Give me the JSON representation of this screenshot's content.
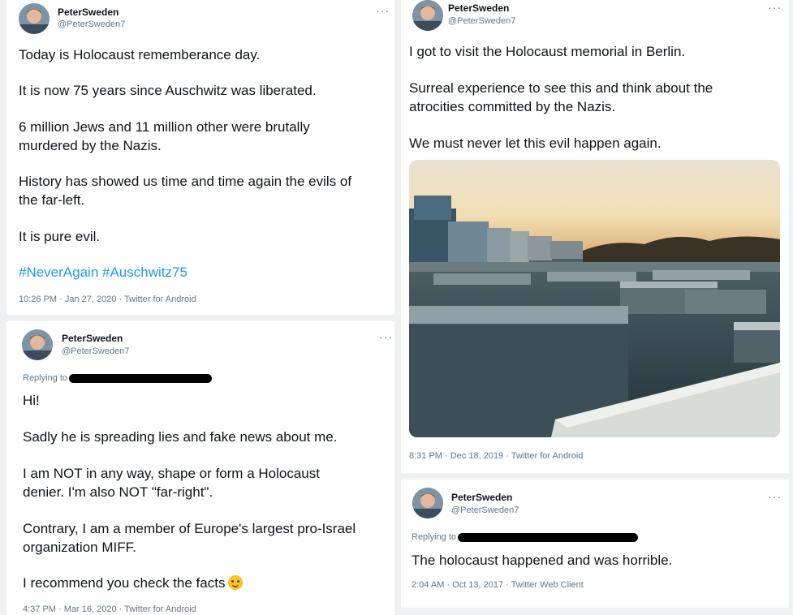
{
  "author": {
    "name": "PeterSweden",
    "handle": "@PeterSweden7"
  },
  "more_label": "···",
  "tweets": [
    {
      "lines": [
        "Today is Holocaust rememberance day.",
        "It is now 75 years since Auschwitz was liberated.",
        "6 million Jews and 11 million other were brutally",
        "murdered by the Nazis.",
        "History has showed us time and time again the evils of",
        "the far-left.",
        "It is pure evil."
      ],
      "hashtags": "#NeverAgain #Auschwitz75",
      "meta": "10:26 PM · Jan 27, 2020 · Twitter for Android"
    },
    {
      "lines": [
        "I got to visit the Holocaust memorial in Berlin.",
        "Surreal experience to see this and think about the",
        "atrocities committed by the Nazis.",
        "We must never let this evil happen again."
      ],
      "meta": "8:31 PM · Dec 18, 2019 · Twitter for Android"
    },
    {
      "replying_to": "Replying to",
      "lines": [
        "Hi!",
        "Sadly he is spreading lies and fake news about me.",
        "I am NOT in any way, shape or form a Holocaust",
        "denier. I'm also NOT \"far-right\".",
        "Contrary, I am a member of Europe's largest pro-Israel",
        "organization MIFF.",
        "I recommend you check the facts"
      ],
      "meta": "4:37 PM · Mar 16, 2020 · Twitter for Android"
    },
    {
      "replying_to": "Replying to",
      "lines": [
        "The holocaust happened and was horrible."
      ],
      "meta": "2:04 AM · Oct 13, 2017 · Twitter Web Client"
    }
  ],
  "icons": {
    "avatar": "profile-photo",
    "more": "more-icon",
    "emoji": "smiling-face-emoji"
  },
  "colors": {
    "link": "#1d9bf0",
    "muted": "#657786",
    "text": "#0f1419"
  }
}
